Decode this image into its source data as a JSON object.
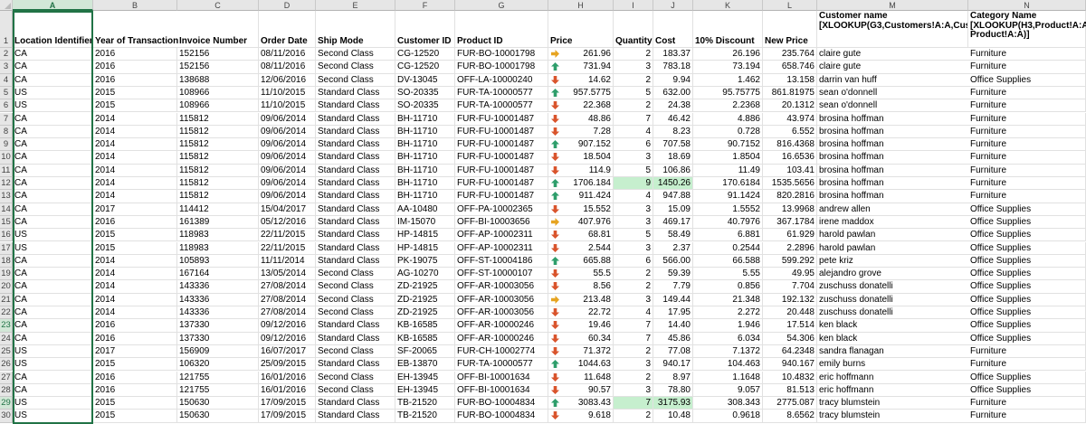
{
  "sheet": {
    "columns": [
      "A",
      "B",
      "C",
      "D",
      "E",
      "F",
      "G",
      "H",
      "I",
      "J",
      "K",
      "L",
      "M",
      "N"
    ],
    "selected_column": "A",
    "header": {
      "location": "Location Identifier",
      "year": "Year of Transaction",
      "invoice": "Invoice Number",
      "order_date": "Order Date",
      "ship_mode": "Ship Mode",
      "customer_id": "Customer ID",
      "product_id": "Product ID",
      "price": "Price",
      "quantity": "Quantity",
      "cost": "Cost",
      "discount": "10% Discount",
      "new_price": "New Price",
      "customer_name": "Customer name [XLOOKUP(G3,Customers!A:A,Customers!B:B)",
      "category_name": "Category Name [XLOOKUP(H3,Product!A:A, Product!A:A)]"
    },
    "rows": [
      {
        "n": "2",
        "loc": "CA",
        "year": "2016",
        "inv": "152156",
        "date": "08/11/2016",
        "ship": "Second Class",
        "cust": "CG-12520",
        "prod": "FUR-BO-10001798",
        "arrow": "side",
        "price": "261.96",
        "qty": "2",
        "cost": "183.37",
        "disc": "26.196",
        "newp": "235.764",
        "name": "claire gute",
        "cat": "Furniture"
      },
      {
        "n": "3",
        "loc": "CA",
        "year": "2016",
        "inv": "152156",
        "date": "08/11/2016",
        "ship": "Second Class",
        "cust": "CG-12520",
        "prod": "FUR-BO-10001798",
        "arrow": "up",
        "price": "731.94",
        "qty": "3",
        "cost": "783.18",
        "disc": "73.194",
        "newp": "658.746",
        "name": "claire gute",
        "cat": "Furniture"
      },
      {
        "n": "4",
        "loc": "CA",
        "year": "2016",
        "inv": "138688",
        "date": "12/06/2016",
        "ship": "Second Class",
        "cust": "DV-13045",
        "prod": "OFF-LA-10000240",
        "arrow": "down",
        "price": "14.62",
        "qty": "2",
        "cost": "9.94",
        "disc": "1.462",
        "newp": "13.158",
        "name": "darrin van huff",
        "cat": "Office Supplies"
      },
      {
        "n": "5",
        "loc": "US",
        "year": "2015",
        "inv": "108966",
        "date": "11/10/2015",
        "ship": "Standard Class",
        "cust": "SO-20335",
        "prod": "FUR-TA-10000577",
        "arrow": "up",
        "price": "957.5775",
        "qty": "5",
        "cost": "632.00",
        "disc": "95.75775",
        "newp": "861.81975",
        "name": "sean o'donnell",
        "cat": "Furniture"
      },
      {
        "n": "6",
        "loc": "US",
        "year": "2015",
        "inv": "108966",
        "date": "11/10/2015",
        "ship": "Standard Class",
        "cust": "SO-20335",
        "prod": "FUR-TA-10000577",
        "arrow": "down",
        "price": "22.368",
        "qty": "2",
        "cost": "24.38",
        "disc": "2.2368",
        "newp": "20.1312",
        "name": "sean o'donnell",
        "cat": "Furniture"
      },
      {
        "n": "7",
        "loc": "CA",
        "year": "2014",
        "inv": "115812",
        "date": "09/06/2014",
        "ship": "Standard Class",
        "cust": "BH-11710",
        "prod": "FUR-FU-10001487",
        "arrow": "down",
        "price": "48.86",
        "qty": "7",
        "cost": "46.42",
        "disc": "4.886",
        "newp": "43.974",
        "name": "brosina hoffman",
        "cat": "Furniture"
      },
      {
        "n": "8",
        "loc": "CA",
        "year": "2014",
        "inv": "115812",
        "date": "09/06/2014",
        "ship": "Standard Class",
        "cust": "BH-11710",
        "prod": "FUR-FU-10001487",
        "arrow": "down",
        "price": "7.28",
        "qty": "4",
        "cost": "8.23",
        "disc": "0.728",
        "newp": "6.552",
        "name": "brosina hoffman",
        "cat": "Furniture"
      },
      {
        "n": "9",
        "loc": "CA",
        "year": "2014",
        "inv": "115812",
        "date": "09/06/2014",
        "ship": "Standard Class",
        "cust": "BH-11710",
        "prod": "FUR-FU-10001487",
        "arrow": "up",
        "price": "907.152",
        "qty": "6",
        "cost": "707.58",
        "disc": "90.7152",
        "newp": "816.4368",
        "name": "brosina hoffman",
        "cat": "Furniture"
      },
      {
        "n": "10",
        "loc": "CA",
        "year": "2014",
        "inv": "115812",
        "date": "09/06/2014",
        "ship": "Standard Class",
        "cust": "BH-11710",
        "prod": "FUR-FU-10001487",
        "arrow": "down",
        "price": "18.504",
        "qty": "3",
        "cost": "18.69",
        "disc": "1.8504",
        "newp": "16.6536",
        "name": "brosina hoffman",
        "cat": "Furniture"
      },
      {
        "n": "11",
        "loc": "CA",
        "year": "2014",
        "inv": "115812",
        "date": "09/06/2014",
        "ship": "Standard Class",
        "cust": "BH-11710",
        "prod": "FUR-FU-10001487",
        "arrow": "down",
        "price": "114.9",
        "qty": "5",
        "cost": "106.86",
        "disc": "11.49",
        "newp": "103.41",
        "name": "brosina hoffman",
        "cat": "Furniture"
      },
      {
        "n": "12",
        "loc": "CA",
        "year": "2014",
        "inv": "115812",
        "date": "09/06/2014",
        "ship": "Standard Class",
        "cust": "BH-11710",
        "prod": "FUR-FU-10001487",
        "arrow": "up",
        "price": "1706.184",
        "qty": "9",
        "cost": "1450.26",
        "disc": "170.6184",
        "newp": "1535.5656",
        "name": "brosina hoffman",
        "cat": "Furniture",
        "hl": true
      },
      {
        "n": "13",
        "loc": "CA",
        "year": "2014",
        "inv": "115812",
        "date": "09/06/2014",
        "ship": "Standard Class",
        "cust": "BH-11710",
        "prod": "FUR-FU-10001487",
        "arrow": "up",
        "price": "911.424",
        "qty": "4",
        "cost": "947.88",
        "disc": "91.1424",
        "newp": "820.2816",
        "name": "brosina hoffman",
        "cat": "Furniture"
      },
      {
        "n": "14",
        "loc": "CA",
        "year": "2017",
        "inv": "114412",
        "date": "15/04/2017",
        "ship": "Standard Class",
        "cust": "AA-10480",
        "prod": "OFF-PA-10002365",
        "arrow": "down",
        "price": "15.552",
        "qty": "3",
        "cost": "15.09",
        "disc": "1.5552",
        "newp": "13.9968",
        "name": "andrew allen",
        "cat": "Office Supplies"
      },
      {
        "n": "15",
        "loc": "CA",
        "year": "2016",
        "inv": "161389",
        "date": "05/12/2016",
        "ship": "Standard Class",
        "cust": "IM-15070",
        "prod": "OFF-BI-10003656",
        "arrow": "side",
        "price": "407.976",
        "qty": "3",
        "cost": "469.17",
        "disc": "40.7976",
        "newp": "367.1784",
        "name": "irene maddox",
        "cat": "Office Supplies"
      },
      {
        "n": "16",
        "loc": "US",
        "year": "2015",
        "inv": "118983",
        "date": "22/11/2015",
        "ship": "Standard Class",
        "cust": "HP-14815",
        "prod": "OFF-AP-10002311",
        "arrow": "down",
        "price": "68.81",
        "qty": "5",
        "cost": "58.49",
        "disc": "6.881",
        "newp": "61.929",
        "name": "harold pawlan",
        "cat": "Office Supplies"
      },
      {
        "n": "17",
        "loc": "US",
        "year": "2015",
        "inv": "118983",
        "date": "22/11/2015",
        "ship": "Standard Class",
        "cust": "HP-14815",
        "prod": "OFF-AP-10002311",
        "arrow": "down",
        "price": "2.544",
        "qty": "3",
        "cost": "2.37",
        "disc": "0.2544",
        "newp": "2.2896",
        "name": "harold pawlan",
        "cat": "Office Supplies"
      },
      {
        "n": "18",
        "loc": "CA",
        "year": "2014",
        "inv": "105893",
        "date": "11/11/2014",
        "ship": "Standard Class",
        "cust": "PK-19075",
        "prod": "OFF-ST-10004186",
        "arrow": "up",
        "price": "665.88",
        "qty": "6",
        "cost": "566.00",
        "disc": "66.588",
        "newp": "599.292",
        "name": "pete kriz",
        "cat": "Office Supplies"
      },
      {
        "n": "19",
        "loc": "CA",
        "year": "2014",
        "inv": "167164",
        "date": "13/05/2014",
        "ship": "Second Class",
        "cust": "AG-10270",
        "prod": "OFF-ST-10000107",
        "arrow": "down",
        "price": "55.5",
        "qty": "2",
        "cost": "59.39",
        "disc": "5.55",
        "newp": "49.95",
        "name": "alejandro grove",
        "cat": "Office Supplies"
      },
      {
        "n": "20",
        "loc": "CA",
        "year": "2014",
        "inv": "143336",
        "date": "27/08/2014",
        "ship": "Second Class",
        "cust": "ZD-21925",
        "prod": "OFF-AR-10003056",
        "arrow": "down",
        "price": "8.56",
        "qty": "2",
        "cost": "7.79",
        "disc": "0.856",
        "newp": "7.704",
        "name": "zuschuss donatelli",
        "cat": "Office Supplies"
      },
      {
        "n": "21",
        "loc": "CA",
        "year": "2014",
        "inv": "143336",
        "date": "27/08/2014",
        "ship": "Second Class",
        "cust": "ZD-21925",
        "prod": "OFF-AR-10003056",
        "arrow": "side",
        "price": "213.48",
        "qty": "3",
        "cost": "149.44",
        "disc": "21.348",
        "newp": "192.132",
        "name": "zuschuss donatelli",
        "cat": "Office Supplies"
      },
      {
        "n": "22",
        "loc": "CA",
        "year": "2014",
        "inv": "143336",
        "date": "27/08/2014",
        "ship": "Second Class",
        "cust": "ZD-21925",
        "prod": "OFF-AR-10003056",
        "arrow": "down",
        "price": "22.72",
        "qty": "4",
        "cost": "17.95",
        "disc": "2.272",
        "newp": "20.448",
        "name": "zuschuss donatelli",
        "cat": "Office Supplies"
      },
      {
        "n": "23",
        "loc": "CA",
        "year": "2016",
        "inv": "137330",
        "date": "09/12/2016",
        "ship": "Standard Class",
        "cust": "KB-16585",
        "prod": "OFF-AR-10000246",
        "arrow": "down",
        "price": "19.46",
        "qty": "7",
        "cost": "14.40",
        "disc": "1.946",
        "newp": "17.514",
        "name": "ken black",
        "cat": "Office Supplies"
      },
      {
        "n": "24",
        "loc": "CA",
        "year": "2016",
        "inv": "137330",
        "date": "09/12/2016",
        "ship": "Standard Class",
        "cust": "KB-16585",
        "prod": "OFF-AR-10000246",
        "arrow": "down",
        "price": "60.34",
        "qty": "7",
        "cost": "45.86",
        "disc": "6.034",
        "newp": "54.306",
        "name": "ken black",
        "cat": "Office Supplies"
      },
      {
        "n": "25",
        "loc": "US",
        "year": "2017",
        "inv": "156909",
        "date": "16/07/2017",
        "ship": "Second Class",
        "cust": "SF-20065",
        "prod": "FUR-CH-10002774",
        "arrow": "down",
        "price": "71.372",
        "qty": "2",
        "cost": "77.08",
        "disc": "7.1372",
        "newp": "64.2348",
        "name": "sandra flanagan",
        "cat": "Furniture"
      },
      {
        "n": "26",
        "loc": "US",
        "year": "2015",
        "inv": "106320",
        "date": "25/09/2015",
        "ship": "Standard Class",
        "cust": "EB-13870",
        "prod": "FUR-TA-10000577",
        "arrow": "up",
        "price": "1044.63",
        "qty": "3",
        "cost": "940.17",
        "disc": "104.463",
        "newp": "940.167",
        "name": "emily burns",
        "cat": "Furniture"
      },
      {
        "n": "27",
        "loc": "CA",
        "year": "2016",
        "inv": "121755",
        "date": "16/01/2016",
        "ship": "Second Class",
        "cust": "EH-13945",
        "prod": "OFF-BI-10001634",
        "arrow": "down",
        "price": "11.648",
        "qty": "2",
        "cost": "8.97",
        "disc": "1.1648",
        "newp": "10.4832",
        "name": "eric hoffmann",
        "cat": "Office Supplies"
      },
      {
        "n": "28",
        "loc": "CA",
        "year": "2016",
        "inv": "121755",
        "date": "16/01/2016",
        "ship": "Second Class",
        "cust": "EH-13945",
        "prod": "OFF-BI-10001634",
        "arrow": "down",
        "price": "90.57",
        "qty": "3",
        "cost": "78.80",
        "disc": "9.057",
        "newp": "81.513",
        "name": "eric hoffmann",
        "cat": "Office Supplies"
      },
      {
        "n": "29",
        "loc": "US",
        "year": "2015",
        "inv": "150630",
        "date": "17/09/2015",
        "ship": "Standard Class",
        "cust": "TB-21520",
        "prod": "FUR-BO-10004834",
        "arrow": "up",
        "price": "3083.43",
        "qty": "7",
        "cost": "3175.93",
        "disc": "308.343",
        "newp": "2775.087",
        "name": "tracy blumstein",
        "cat": "Furniture",
        "hl": true
      },
      {
        "n": "30",
        "loc": "US",
        "year": "2015",
        "inv": "150630",
        "date": "17/09/2015",
        "ship": "Standard Class",
        "cust": "TB-21520",
        "prod": "FUR-BO-10004834",
        "arrow": "down",
        "price": "9.618",
        "qty": "2",
        "cost": "10.48",
        "disc": "0.9618",
        "newp": "8.6562",
        "name": "tracy blumstein",
        "cat": "Furniture"
      }
    ]
  }
}
